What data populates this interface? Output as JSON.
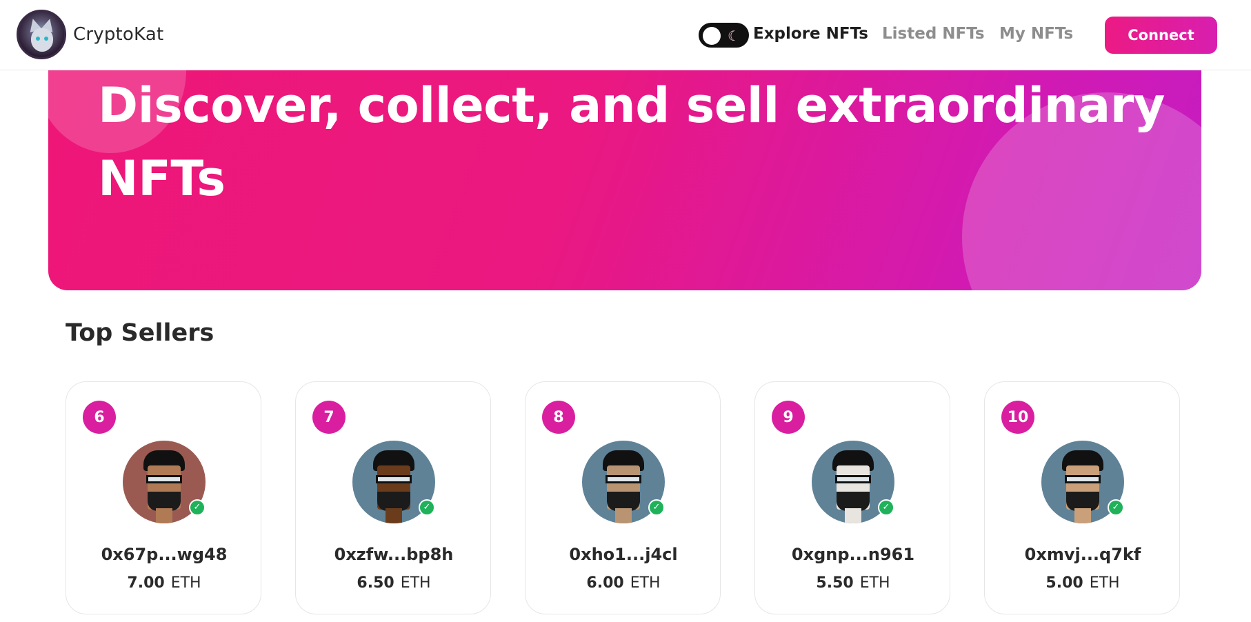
{
  "brand": {
    "name": "CryptoKat",
    "logo_icon": "cat-logo-icon"
  },
  "nav": {
    "theme_toggle_icon": "moon-icon",
    "links": [
      "Explore NFTs",
      "Listed NFTs",
      "My NFTs"
    ],
    "connect_label": "Connect"
  },
  "hero": {
    "title": "Discover, collect, and sell extraordinary NFTs"
  },
  "top_sellers": {
    "title": "Top Sellers",
    "currency": "ETH",
    "sellers": [
      {
        "rank": "6",
        "address": "0x67p...wg48",
        "amount": "7.00",
        "avatar_bg": "#9a5a52",
        "skin": "#b07a54"
      },
      {
        "rank": "7",
        "address": "0xzfw...bp8h",
        "amount": "6.50",
        "avatar_bg": "#5f8297",
        "skin": "#6b3c1c"
      },
      {
        "rank": "8",
        "address": "0xho1...j4cl",
        "amount": "6.00",
        "avatar_bg": "#5f8297",
        "skin": "#b99472"
      },
      {
        "rank": "9",
        "address": "0xgnp...n961",
        "amount": "5.50",
        "avatar_bg": "#5f8297",
        "skin": "#e8e4e0"
      },
      {
        "rank": "10",
        "address": "0xmvj...q7kf",
        "amount": "5.00",
        "avatar_bg": "#5f8297",
        "skin": "#c9a07a"
      }
    ]
  },
  "colors": {
    "accent": "#e91e84",
    "verified": "#1fb25a"
  }
}
